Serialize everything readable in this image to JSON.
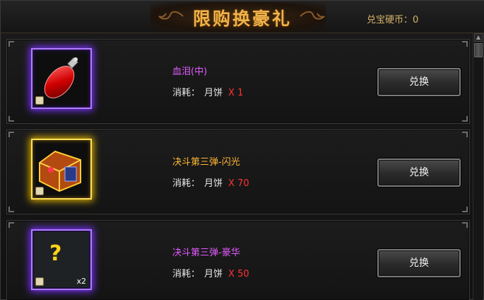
{
  "header": {
    "title": "限购换豪礼",
    "coins_label": "兑宝硬币：",
    "coins_value": "0"
  },
  "items": [
    {
      "name": "血泪(中)",
      "name_color": "#e25cff",
      "cost_label": "消耗：",
      "cost_currency": "月饼",
      "cost_amount": "X 1",
      "button_label": "兑换",
      "quality": "purple",
      "icon": "red-gem-icon",
      "quantity": ""
    },
    {
      "name": "决斗第三弹-闪光",
      "name_color": "#ffb833",
      "cost_label": "消耗：",
      "cost_currency": "月饼",
      "cost_amount": "X 70",
      "button_label": "兑换",
      "quality": "gold",
      "icon": "treasure-chest-icon",
      "quantity": ""
    },
    {
      "name": "决斗第三弹-豪华",
      "name_color": "#e25cff",
      "cost_label": "消耗：",
      "cost_currency": "月饼",
      "cost_amount": "X 50",
      "button_label": "兑换",
      "quality": "purple",
      "icon": "question-mark-icon",
      "quantity": "x2"
    }
  ],
  "colors": {
    "accent_gold": "#f0b24a",
    "cost_red": "#ff3333",
    "quality_purple": "#7a32ff",
    "quality_gold": "#e0b400"
  }
}
